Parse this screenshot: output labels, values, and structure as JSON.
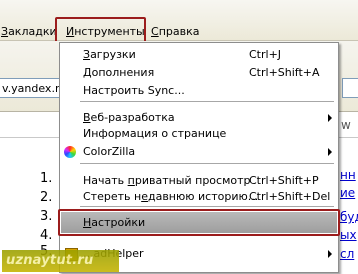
{
  "menubar": {
    "bookmarks": {
      "pre": "",
      "u": "З",
      "post": "акладки"
    },
    "tools": {
      "pre": "",
      "u": "И",
      "post": "нструменты"
    },
    "help": {
      "pre": "",
      "u": "С",
      "post": "правка"
    }
  },
  "address": {
    "url_fragment": "v.yandex.ru"
  },
  "page": {
    "list": [
      "1.",
      "2.",
      "3.",
      "4.",
      "5."
    ],
    "link_fragments": [
      "нн",
      "ие",
      "буд",
      "ых",
      "сл"
    ],
    "tail_char": "w"
  },
  "tools_menu": {
    "downloads": {
      "label_u": "З",
      "label": "агрузки",
      "accel": "Ctrl+J"
    },
    "addons": {
      "label_u": "Д",
      "label": "ополнения",
      "accel": "Ctrl+Shift+A"
    },
    "sync": {
      "label": "Настроить Sync..."
    },
    "webdev": {
      "label_pre": "",
      "label_u": "В",
      "label": "еб-разработка"
    },
    "pageinfo": {
      "label": "Информация о странице"
    },
    "colorzilla": {
      "label": "ColorZilla"
    },
    "private": {
      "label_pre": "Начать ",
      "label_u": "п",
      "label": "риватный просмотр",
      "accel": "Ctrl+Shift+P"
    },
    "clear": {
      "label_pre": "Стереть н",
      "label_u": "е",
      "label": "давнюю историю...",
      "accel": "Ctrl+Shift+Del"
    },
    "settings": {
      "label_u": "Н",
      "label": "астройки"
    },
    "helper": {
      "label": "...adHelper"
    }
  },
  "watermark": {
    "text": "uznaytut.ru"
  },
  "colors": {
    "highlight_frame": "#9b1c1c",
    "menu_bg": "#ffffff",
    "selected_bg": "#a9a9a9"
  }
}
